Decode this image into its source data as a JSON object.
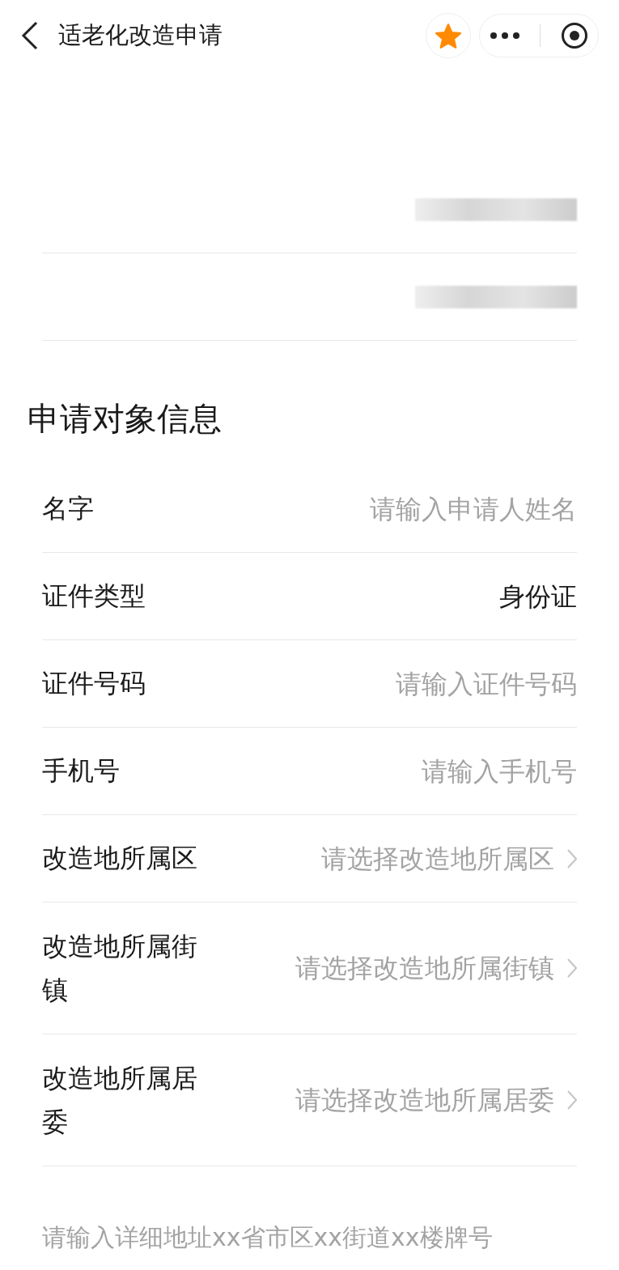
{
  "nav_bar": {
    "title": "适老化改造申请",
    "favorited": true
  },
  "applicant_rows": [
    {
      "redacted": true
    },
    {
      "redacted": true
    }
  ],
  "section": {
    "title": "申请对象信息"
  },
  "fields": [
    {
      "kind": "input",
      "label": "名字",
      "placeholder": "请输入申请人姓名"
    },
    {
      "kind": "select",
      "label": "证件类型",
      "value": "身份证"
    },
    {
      "kind": "input",
      "label": "证件号码",
      "placeholder": "请输入证件号码"
    },
    {
      "kind": "input",
      "label": "手机号",
      "placeholder": "请输入手机号"
    },
    {
      "kind": "picker",
      "label": "改造地所属区",
      "placeholder": "请选择改造地所属区"
    },
    {
      "kind": "picker",
      "label": "改造地所属街镇",
      "placeholder": "请选择改造地所属街镇"
    },
    {
      "kind": "picker",
      "label": "改造地所属居委",
      "placeholder": "请选择改造地所属居委"
    }
  ],
  "address": {
    "placeholder": "请输入详细地址xx省市区xx街道xx楼牌号"
  }
}
